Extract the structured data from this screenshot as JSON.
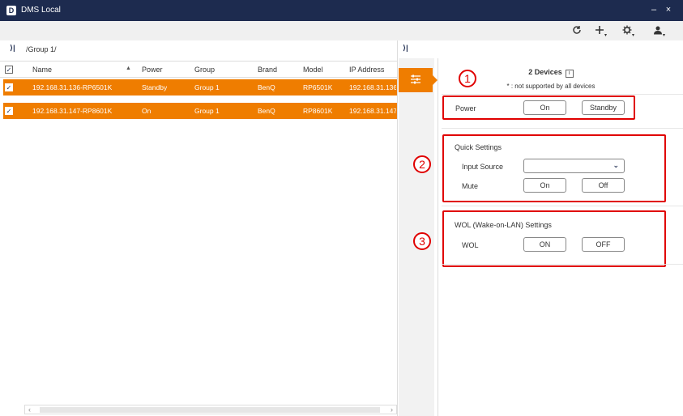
{
  "window": {
    "title": "DMS Local",
    "logo_letter": "D",
    "minimize": "–",
    "close": "×"
  },
  "toolbar": {
    "refresh_icon": "refresh-icon",
    "add_icon": "plus-icon",
    "settings_icon": "gear-icon",
    "account_icon": "user-icon"
  },
  "breadcrumb": {
    "collapse_glyph": "⟩|",
    "path": "/Group 1/"
  },
  "table": {
    "columns": [
      "Name",
      "Power",
      "Group",
      "Brand",
      "Model",
      "IP Address"
    ],
    "rows": [
      {
        "name": "192.168.31.136-RP6501K",
        "power": "Standby",
        "group": "Group 1",
        "brand": "BenQ",
        "model": "RP6501K",
        "ip": "192.168.31.136",
        "checked": true
      },
      {
        "name": "192.168.31.147-RP8601K",
        "power": "On",
        "group": "Group 1",
        "brand": "BenQ",
        "model": "RP8601K",
        "ip": "192.168.31.147",
        "checked": true
      }
    ]
  },
  "panel": {
    "device_count": "2 Devices",
    "info_glyph": "i",
    "note": "* : not supported by all devices",
    "power": {
      "label": "Power",
      "on": "On",
      "standby": "Standby"
    },
    "quick": {
      "title": "Quick Settings",
      "input_source_label": "Input Source",
      "input_source_value": "",
      "mute_label": "Mute",
      "mute_on": "On",
      "mute_off": "Off"
    },
    "wol": {
      "title": "WOL (Wake-on-LAN) Settings",
      "label": "WOL",
      "on": "ON",
      "off": "OFF"
    },
    "callouts": [
      "1",
      "2",
      "3"
    ]
  },
  "colors": {
    "accent": "#ef7d00",
    "titlebar": "#1d2b4f",
    "callout": "#e00000"
  }
}
